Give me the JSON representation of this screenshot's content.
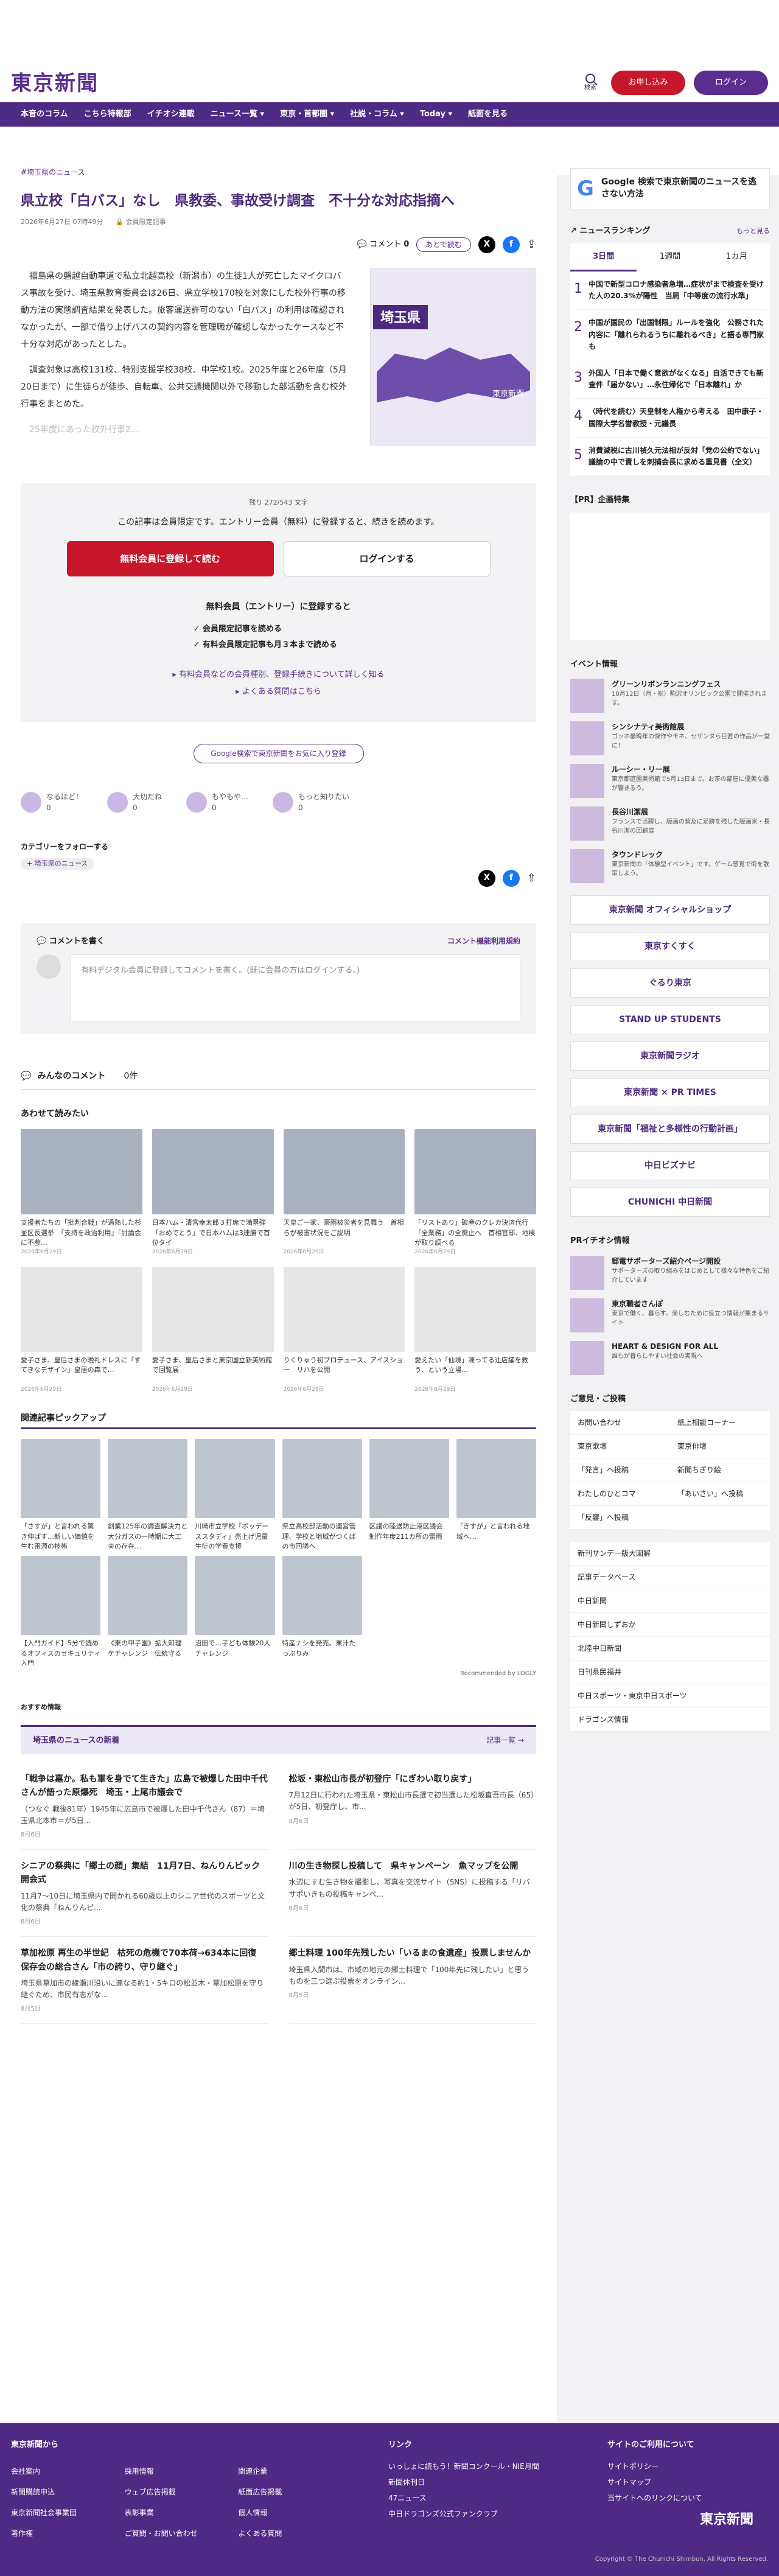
{
  "header": {
    "logo": "東京新聞",
    "search": "検索",
    "apply": "お申し込み",
    "login": "ログイン"
  },
  "nav": [
    "本音のコラム",
    "こちら特報部",
    "イチオシ連載",
    "ニュース一覧 ▾",
    "東京・首都圏 ▾",
    "社説・コラム ▾",
    "Today ▾",
    "紙面を見る"
  ],
  "article": {
    "crumb": "埼玉県のニュース",
    "title": "県立校「白バス」なし　県教委、事故受け調査　不十分な対応指摘へ",
    "date": "2026年6月27日 07時49分",
    "member": "会員限定記事",
    "comment": "コメント",
    "comment_count": "0",
    "later": "あとで読む",
    "paras": [
      "福島県の磐越自動車道で私立北越高校（新潟市）の生徒1人が死亡したマイクロバス事故を受け、埼玉県教育委員会は26日、県立学校170校を対象にした校外行事の移動方法の実態調査結果を発表した。旅客運送許可のない「白バス」の利用は確認されなかったが、一部で借り上げバスの契約内容を管理職が確認しなかったケースなど不十分な対応があったとした。",
      "調査対象は高校131校、特別支援学校38校、中学校1校。2025年度と26年度（5月20日まで）に生徒らが徒歩、自転車、公共交通機関以外で移動した部活動を含む校外行事をまとめた。"
    ],
    "fade": "25年度にあった校外行事2...",
    "map_label": "埼玉県",
    "map_brand": "東京新聞"
  },
  "paywall": {
    "count": "残り 272/543 文字",
    "text": "この記事は会員限定です。エントリー会員（無料）に登録すると、続きを読めます。",
    "register": "無料会員に登録して読む",
    "login": "ログインする",
    "subhead": "無料会員（エントリー）に登録すると",
    "benefits": [
      "会員限定記事を読める",
      "有料会員限定記事も月３本まで読める"
    ],
    "link1": "有料会員などの会員種別、登録手続きについて詳しく知る",
    "link2": "よくある質問はこちら"
  },
  "follow": "Google検索で東京新聞をお気に入り登録",
  "reactions": [
    {
      "label": "なるほど！",
      "n": "0"
    },
    {
      "label": "大切だね",
      "n": "0"
    },
    {
      "label": "もやもや…",
      "n": "0"
    },
    {
      "label": "もっと知りたい",
      "n": "0"
    }
  ],
  "category": {
    "title": "カテゴリーをフォローする",
    "tag": "+ 埼玉県のニュース"
  },
  "comment_box": {
    "title": "コメントを書く",
    "rule": "コメント機能利用規約",
    "prompt": "有料デジタル会員に登録してコメントを書く。(既に会員の方はログインする。)"
  },
  "comments": {
    "title": "みんなのコメント",
    "count": "0件"
  },
  "also": {
    "title": "あわせて読みたい",
    "items": [
      {
        "cap": "支援者たちの「批判合戦」が過熱した杉並区長選挙　「支持を政治利用」「討論会に不参...",
        "dt": "2026年6月29日"
      },
      {
        "cap": "日本ハム・清宮幸太郎３打席で満塁弾「おめでとう」で日本ハムは3連勝で首位タイ",
        "dt": "2026年6月29日"
      },
      {
        "cap": "天皇ご一家、豪雨被災者を見舞う　首相らが被害状況をご説明",
        "dt": "2026年6月29日"
      },
      {
        "cap": "「リストあり」破産のクレカ決済代行「全業務」の全廃止へ　首相官邸、地検が取り調べる",
        "dt": "2026年6月29日"
      },
      {
        "cap": "愛子さま、皇后さまの晩礼ドレスに「すてきなデザイン」皇居の森で…",
        "dt": "2026年6月29日"
      },
      {
        "cap": "愛子さま、皇后さまと東京国立新美術館で回覧展",
        "dt": "2026年6月29日"
      },
      {
        "cap": "りくりゅう初プロデュース、アイスショー　リハを公開",
        "dt": "2026年6月29日"
      },
      {
        "cap": "愛えたい「仙境」凍ってる辻店舗を救う、という立場…",
        "dt": "2026年6月29日"
      }
    ]
  },
  "pickup": {
    "title": "関連記事ピックアップ",
    "items": [
      "「さすが」と言われる驚き伸ばす…新しい価値を生む電源の技術",
      "創業125年の調査解決力と大分ガスの一時期に大工夫の存在…",
      "川崎市立学校「ボッデーススタディ」売上げ児童生徒の学費支援",
      "県立高校部活動の運営管理、学校と地域がつくばの市回議へ",
      "区議の陸送防止港区議会制作年度211カ所の雷雨",
      "「きすが」と言われる地域へ…",
      "【入門ガイド】5分で読めるオフィスのセキュリティ入門",
      "《東の甲子園》拡大知理ケチャレンジ　伝統守る",
      "沼田で…子ども体験20人チャレンジ",
      "特産ナシを発売、果汁たっぷりみ"
    ],
    "credit": "Recommended by LOGLY"
  },
  "osusume": "おすすめ情報",
  "newsbox": {
    "title": "埼玉県のニュースの新着",
    "more": "記事一覧",
    "items": [
      {
        "t": "「戦争は嘉か。私も軍を身でて生きた」広島で被爆した田中千代さんが語った原爆死　埼玉・上尾市議会で",
        "s": "（つなぐ 戦後81年）1945年に広島市で被爆した田中千代さん（87）＝埼玉県北本市＝が5日...",
        "d": "8月6日"
      },
      {
        "t": "松坂・東松山市長が初登庁「にぎわい取り戻す」",
        "s": "7月12日に行われた埼玉県・東松山市長選で初当選した松坂直吾市長（65）が5日、初登庁し、市...",
        "d": "8月6日"
      },
      {
        "t": "シニアの祭典に「郷土の顔」集結　11月7日、ねんりんピック開会式",
        "s": "11月7〜10日に埼玉県内で開かれる60歳以上のシニア世代のスポーツと文化の祭典「ねんりんピ...",
        "d": "8月6日"
      },
      {
        "t": "川の生き物探し投稿して　県キャンペーン　魚マップを公開",
        "s": "水辺にすむ生き物を撮影し、写真を交流サイト（SNS）に投稿する「リバサポいきもの投稿キャンペ...",
        "d": "8月6日"
      },
      {
        "t": "草加松原 再生の半世紀　枯死の危機で70本荷→634本に回復　保存会の総合さん「市の誇り、守り継ぐ」",
        "s": "埼玉県草加市の綾瀬川沿いに連なる約1・5キロの松並木・草加松原を守り継ぐため、市民有志がな...",
        "d": "8月5日"
      },
      {
        "t": "郷土料理 100年先残したい「いるまの食遺産」投票しませんか",
        "s": "埼玉県入間市は、市域の地元の郷土料理で「100年先に残したい」と思うものを三つ選ぶ投票をオンライン...",
        "d": "8月5日"
      }
    ]
  },
  "sidebar": {
    "ad": "Google 検索で東京新聞のニュースを逃さない方法",
    "rank_title": "ニュースランキング",
    "rank_more": "もっと見る",
    "tabs": [
      "3日間",
      "1週間",
      "1カ月"
    ],
    "rank": [
      "中国で新型コロナ感染者急増…症状がまで検査を受けた人の20.3%が陽性　当局「中等度の流行水準」",
      "中国が国民の「出国制限」ルールを強化　公務された内容に「離れられるうちに離れるべき」と語る専門家も",
      "外国人「日本で働く意欲がなくなる」自活できても新査件「届かない」…永住帰化で「日本離れ」か",
      "〈時代を読む〉天皇制を人権から考える　田中康子・国際大学名誉教授・元議長",
      "消費減税に古川禎久元法相が反対「党の公約でない」議論の中で責しを刺捕会長に求める重見書（全文）"
    ],
    "pr_title": "【PR】企画特集",
    "event_title": "イベント情報",
    "events": [
      {
        "t": "グリーンリボンランニングフェス",
        "s": "10月12日（月・祝）駒沢オリンピック公園で開催されます。"
      },
      {
        "t": "シンシナティ美術館展",
        "s": "ゴッホ最晩年の傑作やモネ、セザンヌら巨匠の作品が一堂に！"
      },
      {
        "t": "ルーシー・リー展",
        "s": "東京都庭園美術館で5月13日まで。お茶の部屋に優美な器が響きるう。"
      },
      {
        "t": "長谷川潔展",
        "s": "フランスで活躍し、版画の普及に足跡を残した版画家・長谷川潔の回顧展"
      },
      {
        "t": "タウンドレック",
        "s": "東京新聞の「体験型イベント」です。ゲーム感覚で街を散策しよう。"
      }
    ],
    "banners": [
      "東京新聞 オフィシャルショップ",
      "東京すくすく",
      "ぐるり東京",
      "STAND UP STUDENTS",
      "東京新聞ラジオ",
      "東京新聞 × PR TIMES",
      "東京新聞「福祉と多様性の行動計画」",
      "中日ビズナビ",
      "CHUNICHI 中日新聞"
    ],
    "pr2_title": "PRイチオシ情報",
    "pr2": [
      {
        "t": "郵電サポーターズ紹介ページ開設",
        "s": "サポーターズの取り組みをはじめとして様々な特色をご紹介しています"
      },
      {
        "t": "東京職者さんぽ",
        "s": "東京で働く、暮らす、楽しむために役立つ情報が集まるサイト"
      },
      {
        "t": "HEART & DESIGN FOR ALL",
        "s": "誰もが暮らしやすい社会の実現へ"
      }
    ],
    "guide_title": "ご意見・ご投稿",
    "guide": [
      "お問い合わせ",
      "紙上相談コーナー",
      "東京歌壇",
      "東京俳壇",
      "「発言」へ投稿",
      "新聞ちぎり絵",
      "わたしのひとコマ",
      "「あいさい」へ投稿",
      "「反響」へ投稿"
    ],
    "links": [
      "新刊サンデー版大図解",
      "記事データベース",
      "中日新聞",
      "中日新聞しずおか",
      "北陸中日新聞",
      "日刊県民福井",
      "中日スポーツ・東京中日スポーツ",
      "ドラゴンズ情報"
    ]
  },
  "footer": {
    "c1_title": "東京新聞から",
    "c1": [
      "会社案内",
      "採用情報",
      "関連企業",
      "新聞購読申込",
      "ウェブ広告掲載",
      "紙面広告掲載",
      "東京新聞社会事業団",
      "表彰事業",
      "個人情報",
      "著作権",
      "ご質問・お問い合わせ",
      "よくある質問"
    ],
    "c2_title": "リンク",
    "c2": [
      "いっしょに読もう！新聞コンクール・NIE月間",
      "新聞休刊日",
      "47ニュース",
      "中日ドラゴンズ公式ファンクラブ"
    ],
    "c3_title": "サイトのご利用について",
    "c3": [
      "サイトポリシー",
      "サイトマップ",
      "当サイトへのリンクについて"
    ],
    "logo": "東京新聞",
    "copy": "Copyright © The Chunichi Shimbun, All Rights Reserved."
  },
  "colors": {
    "brand": "#4e2a84",
    "accent": "#c8162a"
  }
}
